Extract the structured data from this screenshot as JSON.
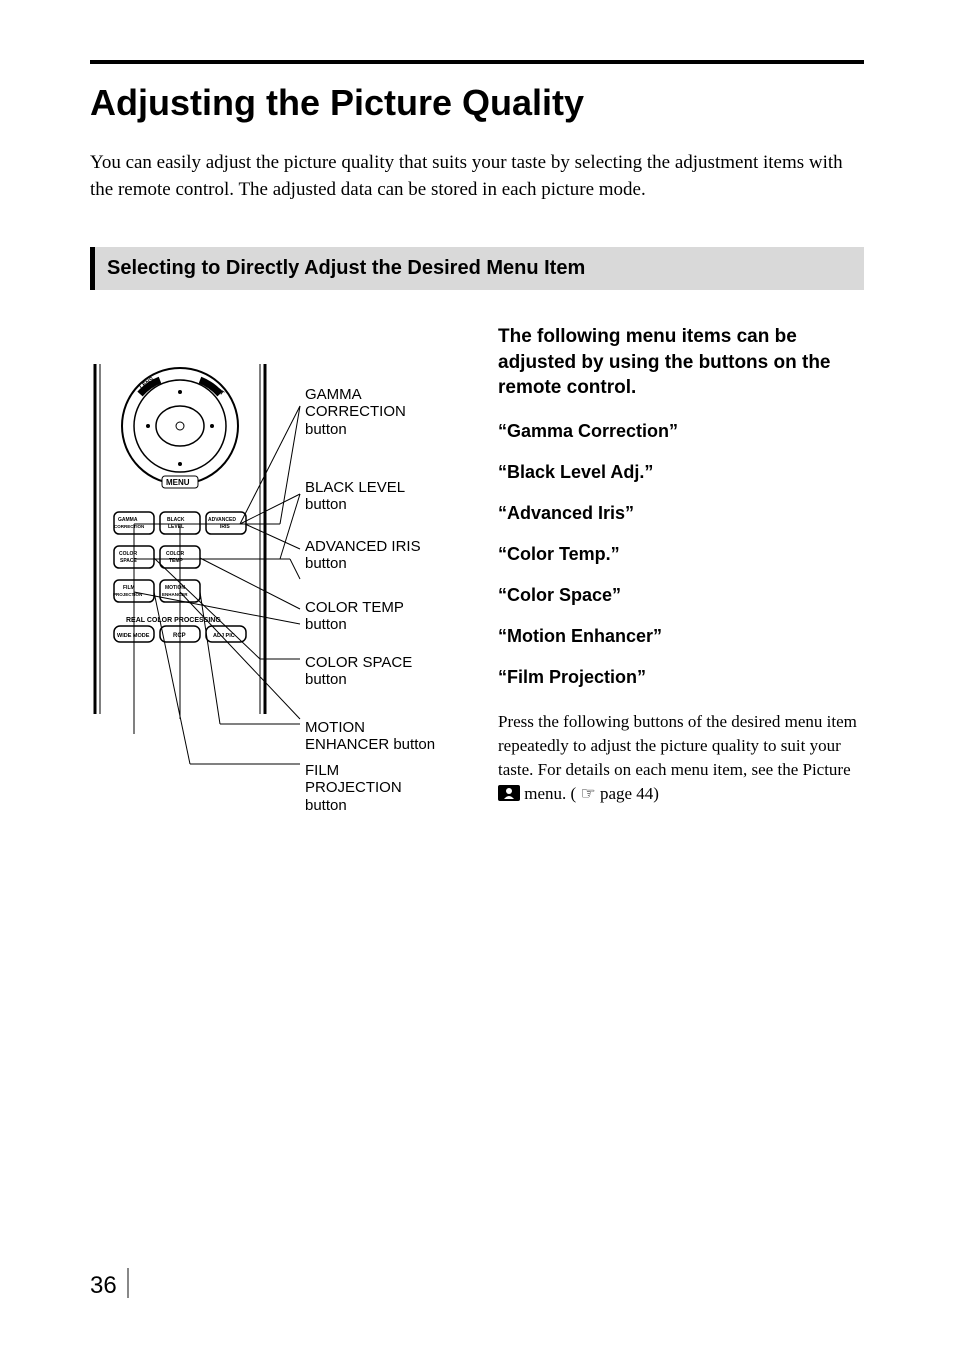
{
  "page": {
    "title": "Adjusting the Picture Quality",
    "intro": "You can easily adjust the picture quality that suits your taste by selecting the adjustment items with the remote control. The adjusted data can be stored in each picture mode.",
    "section_title": "Selecting to Directly Adjust the Desired Menu Item",
    "page_number": "36"
  },
  "figure": {
    "callouts": {
      "gamma": "GAMMA CORRECTION button",
      "black_level": "BLACK LEVEL button",
      "advanced_iris": "ADVANCED IRIS button",
      "color_temp": "COLOR TEMP button",
      "color_space": "COLOR SPACE button",
      "motion_enhancer": "MOTION ENHANCER button",
      "film_projection": "FILM PROJECTION button"
    },
    "remote_buttons": {
      "top_dial": {
        "menu": "MENU",
        "lens": "LENS",
        "reset": "RESET"
      },
      "row1": [
        "GAMMA CORRECTION",
        "BLACK LEVEL",
        "ADVANCED IRIS"
      ],
      "row2": [
        "COLOR SPACE",
        "COLOR TEMP"
      ],
      "row3": [
        "FILM PROJECTION",
        "MOTION ENHANCER"
      ],
      "row4_label": "REAL COLOR PROCESSING",
      "row4": [
        "WIDE MODE",
        "RCP",
        "ADJ PIC"
      ]
    }
  },
  "right": {
    "lead": "The following menu items can be adjusted by using the buttons on the remote control.",
    "items": [
      "“Gamma Correction”",
      "“Black Level Adj.”",
      "“Advanced Iris”",
      "“Color Temp.”",
      "“Color Space”",
      "“Motion Enhancer”",
      "“Film Projection”"
    ],
    "body_pre": "Press the following buttons of the desired menu item repeatedly to adjust the picture quality to suit your taste.  For details on each menu item, see the Picture ",
    "body_mid": " menu. (",
    "body_ref": " page 44)"
  }
}
